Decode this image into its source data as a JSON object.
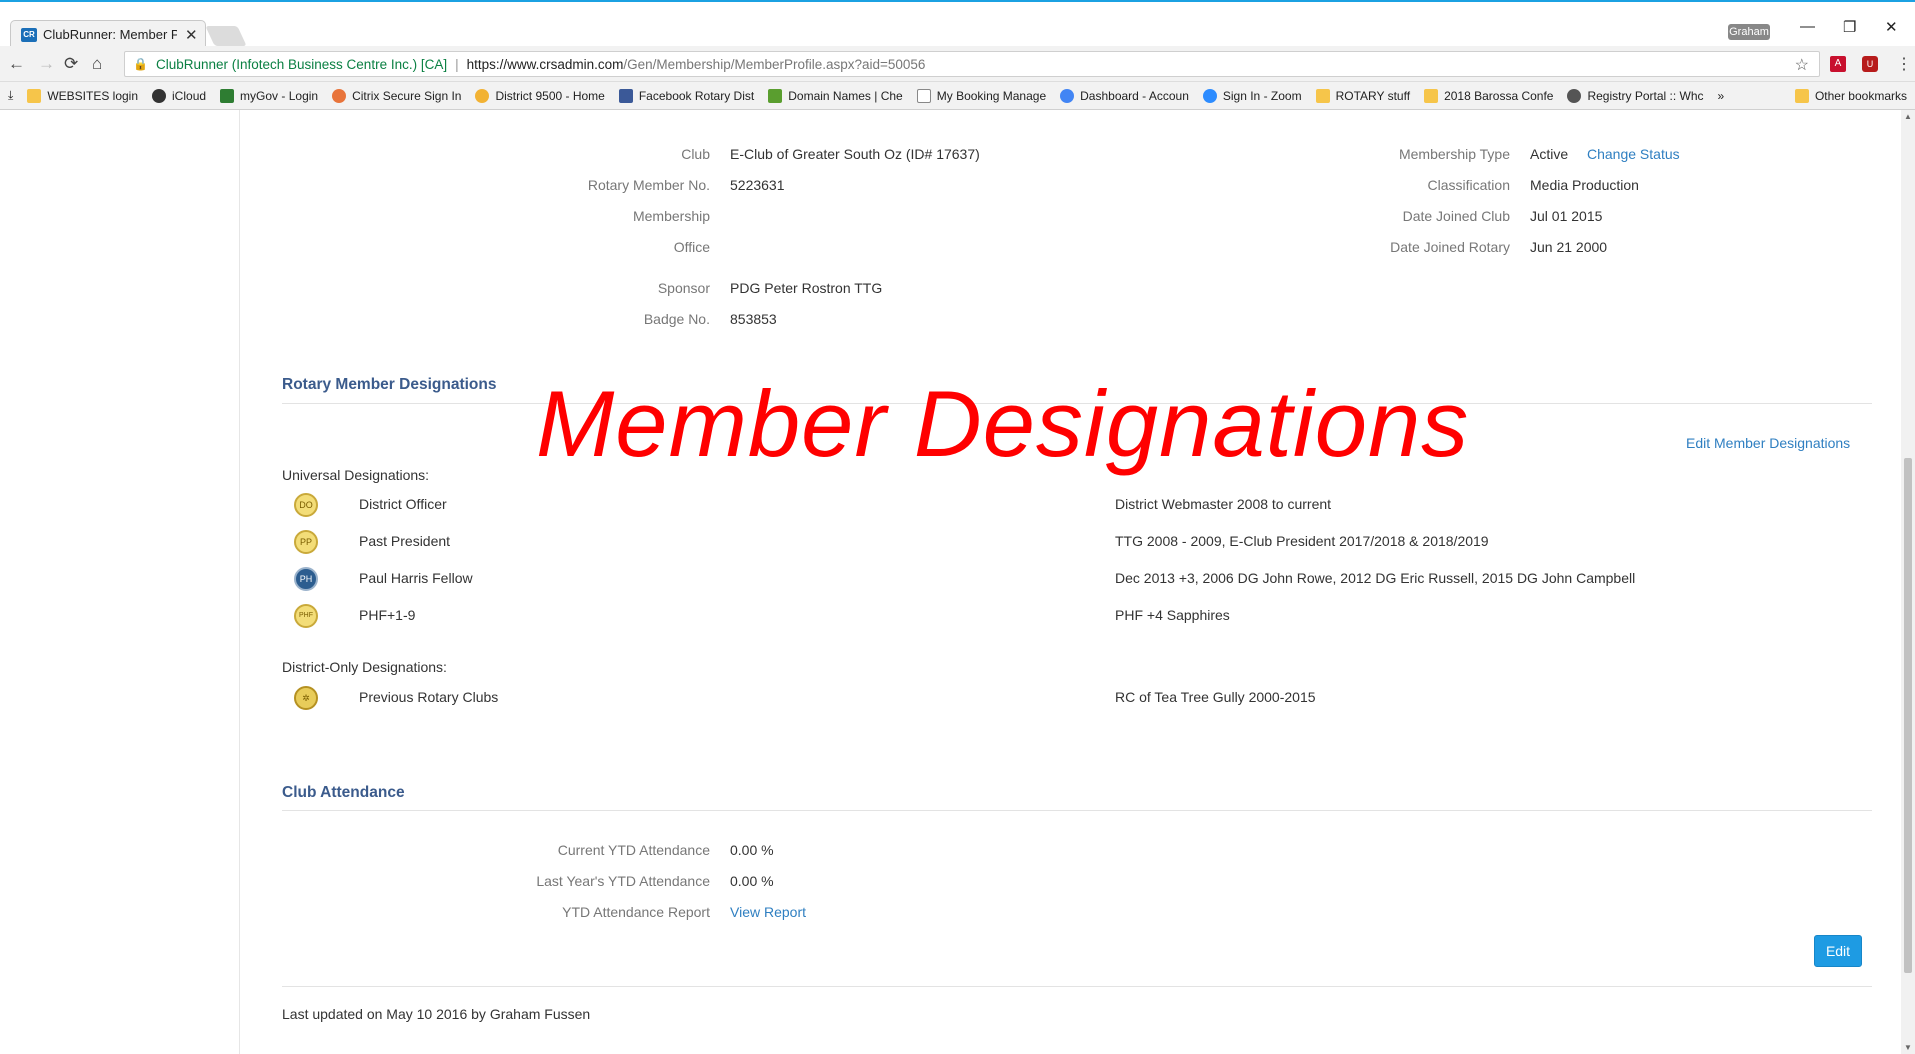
{
  "browser": {
    "tab_title": "ClubRunner: Member Pr",
    "tab_favicon": "CR",
    "tab_close": "✕",
    "profile_name": "Graham",
    "window_controls": [
      "—",
      "❐",
      "✕"
    ],
    "nav": {
      "back": "←",
      "forward": "→",
      "reload": "⟳",
      "home": "⌂"
    },
    "origin_label": "ClubRunner (Infotech Business Centre Inc.) [CA]",
    "url_host": "https://www.crsadmin.com",
    "url_path": "/Gen/Membership/MemberProfile.aspx?aid=50056",
    "star": "☆",
    "menu": "⋮",
    "bookmarks": [
      {
        "label": "WEBSITES login",
        "icon": "folder-icon",
        "color": "#f6c54a"
      },
      {
        "label": "iCloud",
        "icon": "apple-icon",
        "color": "#333333"
      },
      {
        "label": "myGov - Login",
        "icon": "mygov-icon",
        "color": "#2e7d32"
      },
      {
        "label": "Citrix Secure Sign In",
        "icon": "citrix-icon",
        "color": "#e8743b"
      },
      {
        "label": "District 9500 - Home",
        "icon": "district-icon",
        "color": "#f2b233"
      },
      {
        "label": "Facebook Rotary Dist",
        "icon": "facebook-icon",
        "color": "#3b5998"
      },
      {
        "label": "Domain Names | Che",
        "icon": "domain-icon",
        "color": "#5a9e2f"
      },
      {
        "label": "My Booking Manage",
        "icon": "page-icon",
        "color": "#dddddd"
      },
      {
        "label": "Dashboard - Accoun",
        "icon": "google-icon",
        "color": "#4285f4"
      },
      {
        "label": "Sign In - Zoom",
        "icon": "zoom-icon",
        "color": "#2d8cff"
      },
      {
        "label": "ROTARY stuff",
        "icon": "folder-icon",
        "color": "#f6c54a"
      },
      {
        "label": "2018 Barossa Confe",
        "icon": "folder-icon",
        "color": "#f6c54a"
      },
      {
        "label": "Registry Portal :: Whc",
        "icon": "registry-icon",
        "color": "#555555"
      }
    ],
    "bookmarks_more": "»",
    "other_bookmarks": "Other bookmarks"
  },
  "profile": {
    "left_fields": [
      {
        "label": "Club",
        "value": "E-Club of Greater South Oz (ID# 17637)"
      },
      {
        "label": "Rotary Member No.",
        "value": "5223631"
      },
      {
        "label": "Membership",
        "value": ""
      },
      {
        "label": "Office",
        "value": ""
      },
      {
        "label": "Sponsor",
        "value": "PDG Peter Rostron TTG"
      },
      {
        "label": "Badge No.",
        "value": "853853"
      }
    ],
    "right_fields": [
      {
        "label": "Membership Type",
        "value": "Active",
        "link": "Change Status"
      },
      {
        "label": "Classification",
        "value": "Media Production"
      },
      {
        "label": "Date Joined Club",
        "value": "Jul 01 2015"
      },
      {
        "label": "Date Joined Rotary",
        "value": "Jun 21 2000"
      }
    ]
  },
  "designations": {
    "title": "Rotary Member Designations",
    "overlay_text": "Member Designations",
    "edit_link": "Edit Member Designations",
    "universal_label": "Universal Designations:",
    "universal": [
      {
        "icon": "district-officer-icon",
        "icon_text": "DO",
        "name": "District Officer",
        "note": "District Webmaster 2008 to current"
      },
      {
        "icon": "past-president-icon",
        "icon_text": "PP",
        "name": "Past President",
        "note": "TTG 2008 - 2009, E-Club President 2017/2018 & 2018/2019"
      },
      {
        "icon": "paul-harris-icon",
        "icon_text": "PH",
        "name": "Paul Harris Fellow",
        "note": "Dec 2013 +3, 2006 DG John Rowe, 2012 DG Eric Russell, 2015 DG John Campbell"
      },
      {
        "icon": "phf-icon",
        "icon_text": "PHF",
        "name": "PHF+1-9",
        "note": "PHF +4 Sapphires"
      }
    ],
    "district_label": "District-Only Designations:",
    "district": [
      {
        "icon": "rotary-wheel-icon",
        "icon_text": "✲",
        "name": "Previous Rotary Clubs",
        "note": "RC of Tea Tree Gully 2000-2015"
      }
    ]
  },
  "attendance": {
    "title": "Club Attendance",
    "fields": [
      {
        "label": "Current YTD Attendance",
        "value": "0.00 %"
      },
      {
        "label": "Last Year's YTD Attendance",
        "value": "0.00 %"
      },
      {
        "label": "YTD Attendance Report",
        "value": "View Report"
      }
    ],
    "edit_button": "Edit"
  },
  "footer": {
    "last_updated": "Last updated on May 10 2016 by Graham Fussen"
  },
  "colors": {
    "link": "#2f7fc1",
    "section_title": "#3b5b8c",
    "overlay": "#ff0000",
    "edit_button": "#1e9be3"
  }
}
